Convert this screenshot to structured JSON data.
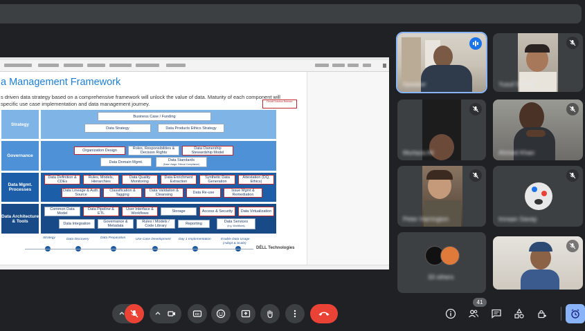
{
  "slide": {
    "title": "a Management Framework",
    "subtitle_line1": "s driven data strategy based on a comprehensive framework will unlock the value of data.  Maturity of each component will",
    "subtitle_line2": "specific use case implementation and data management journey.",
    "badge": "Recall Solution Release",
    "rows": [
      {
        "label": "Strategy",
        "boxes": [
          "Business Case / Funding",
          "Data Strategy",
          "Data Products Ethics Strategy"
        ]
      },
      {
        "label": "Governance",
        "boxes": [
          "Organization Design",
          "Roles, Responsibilities & Decision Rights",
          "Data Ownership Stewardship Model",
          "Data Domain Mgmt.",
          "Data Standards",
          "(Data Usage, Ethical Compliance)"
        ]
      },
      {
        "label": "Data Mgmt. Processes",
        "boxes": [
          "Data Definition & CDEs",
          "Rules, Models, Hierarchies",
          "Data Quality Monitoring",
          "Data Enrichment Extraction",
          "Synthetic Data Generation",
          "Attestation (DQ, Ethics)",
          "Data Lineage & Auth. Source",
          "Classification & Tagging",
          "Data Validation & Cleansing",
          "Data Re-use",
          "Issue Mgmt & Remediation"
        ]
      },
      {
        "label": "Data Architecture & Tools",
        "boxes": [
          "Common Data Model",
          "Data Pipeline & ETL",
          "User Interface & Workflows",
          "Storage",
          "Access & Security",
          "Data Virtualization",
          "Data Integration",
          "Governance & Metadata",
          "Rules / Models / Code Library",
          "Reporting",
          "Data Services",
          "(e.g. Workflows)"
        ]
      }
    ],
    "timeline": [
      "Strategy",
      "Data Discovery",
      "Data Preparation",
      "Use Case Development",
      "Day 1 Implementation",
      "Enable Data Usage",
      "(Adopt & Scale)"
    ],
    "brand": "DÉLL Technologies"
  },
  "participants": [
    {
      "name": "Speaker",
      "speaking": true
    },
    {
      "name": "Yusuf Sheikh",
      "muted": true
    },
    {
      "name": "Murtaza Ali",
      "muted": true
    },
    {
      "name": "Ahmed Khan",
      "muted": true
    },
    {
      "name": "Peter Harrington",
      "muted": true
    },
    {
      "name": "Imraan Savay",
      "muted": true
    },
    {
      "name": "33 others"
    },
    {
      "name": "",
      "muted": true
    }
  ],
  "toolbar": {
    "participant_count": "41"
  },
  "colors": {
    "background": "#202124",
    "tile": "#3c4043",
    "danger": "#ea4335",
    "accent": "#8ab4f8",
    "slide_strategy": "#7fb4e6",
    "slide_governance": "#4f91d6",
    "slide_processes": "#1d5ea8",
    "slide_arch": "#174a86"
  }
}
